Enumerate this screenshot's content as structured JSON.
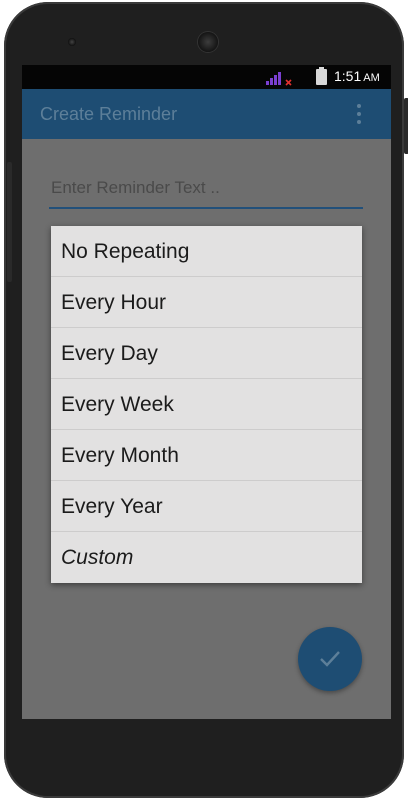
{
  "status_bar": {
    "time": "1:51",
    "ampm": "AM",
    "icons": [
      "signal-icon",
      "no-sim-icon",
      "battery-icon"
    ]
  },
  "app_bar": {
    "title": "Create Reminder",
    "overflow_icon": "more-vert-icon"
  },
  "reminder_input": {
    "placeholder": "Enter Reminder Text ..",
    "value": ""
  },
  "repeat_menu": {
    "items": [
      "No Repeating",
      "Every Hour",
      "Every Day",
      "Every Week",
      "Every Month",
      "Every Year",
      "Custom"
    ]
  },
  "fab": {
    "icon": "check-icon"
  },
  "colors": {
    "primary": "#1e4d73",
    "accent": "#22507a",
    "menu_bg": "#e2e1e1",
    "dim_bg": "#6e6e6e",
    "signal": "#7a3fd1",
    "no_sim": "#e0302f"
  }
}
